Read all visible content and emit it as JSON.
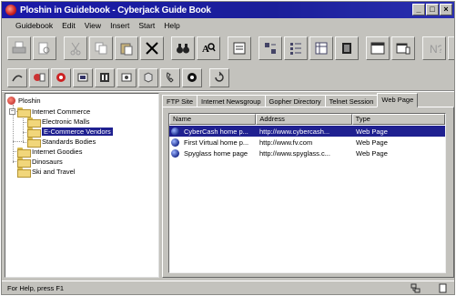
{
  "window": {
    "title": "Ploshin in Guidebook - Cyberjack Guide Book"
  },
  "window_controls": {
    "minimize": "_",
    "maximize": "□",
    "close": "×"
  },
  "menu": [
    "Guidebook",
    "Edit",
    "View",
    "Insert",
    "Start",
    "Help"
  ],
  "tree": {
    "root": "Ploshin",
    "items": [
      {
        "label": "Internet Commerce",
        "level": 1,
        "toggle": "−"
      },
      {
        "label": "Electronic Malls",
        "level": 2
      },
      {
        "label": "E-Commerce Vendors",
        "level": 2,
        "selected": true
      },
      {
        "label": "Standards Bodies",
        "level": 2
      },
      {
        "label": "Internet Goodies",
        "level": 1
      },
      {
        "label": "Dinosaurs",
        "level": 1
      },
      {
        "label": "Ski and Travel",
        "level": 1
      }
    ]
  },
  "tabs": [
    "FTP Site",
    "Internet Newsgroup",
    "Gopher Directory",
    "Telnet Session",
    "Web Page"
  ],
  "active_tab": "Web Page",
  "list": {
    "columns": [
      "Name",
      "Address",
      "Type"
    ],
    "rows": [
      {
        "name": "CyberCash home p...",
        "address": "http://www.cybercash...",
        "type": "Web Page",
        "selected": true
      },
      {
        "name": "First Virtual home p...",
        "address": "http://www.fv.com",
        "type": "Web Page"
      },
      {
        "name": "Spyglass home page",
        "address": "http://www.spyglass.c...",
        "type": "Web Page"
      }
    ]
  },
  "status": {
    "text": "For Help, press F1"
  },
  "colors": {
    "title_bar": "#1a1aa8",
    "selection": "#1f2090",
    "chrome": "#c3c2bd"
  }
}
